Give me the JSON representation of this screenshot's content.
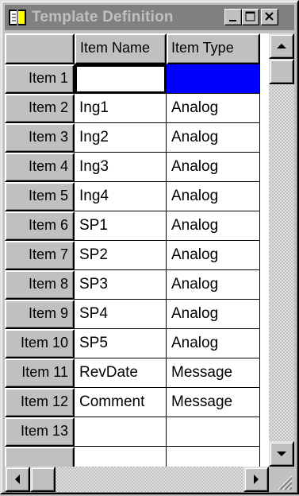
{
  "window": {
    "title": "Template Definition",
    "icon": "book-icon",
    "controls": [
      "minimize-icon",
      "maximize-icon",
      "close-icon"
    ]
  },
  "grid": {
    "columns": [
      "Item Name",
      "Item Type"
    ],
    "rows": [
      {
        "header": "Item 1",
        "name": "",
        "type": "",
        "selected_type_cell": true
      },
      {
        "header": "Item 2",
        "name": "Ing1",
        "type": "Analog"
      },
      {
        "header": "Item 3",
        "name": "Ing2",
        "type": "Analog"
      },
      {
        "header": "Item 4",
        "name": "Ing3",
        "type": "Analog"
      },
      {
        "header": "Item 5",
        "name": "Ing4",
        "type": "Analog"
      },
      {
        "header": "Item 6",
        "name": "SP1",
        "type": "Analog"
      },
      {
        "header": "Item 7",
        "name": "SP2",
        "type": "Analog"
      },
      {
        "header": "Item 8",
        "name": "SP3",
        "type": "Analog"
      },
      {
        "header": "Item 9",
        "name": "SP4",
        "type": "Analog"
      },
      {
        "header": "Item 10",
        "name": "SP5",
        "type": "Analog"
      },
      {
        "header": "Item 11",
        "name": "RevDate",
        "type": "Message"
      },
      {
        "header": "Item 12",
        "name": "Comment",
        "type": "Message"
      },
      {
        "header": "Item 13",
        "name": "",
        "type": ""
      }
    ]
  },
  "colors": {
    "selection": "#0000ff",
    "face": "#c0c0c0",
    "inactive_titlebar": "#808080"
  }
}
